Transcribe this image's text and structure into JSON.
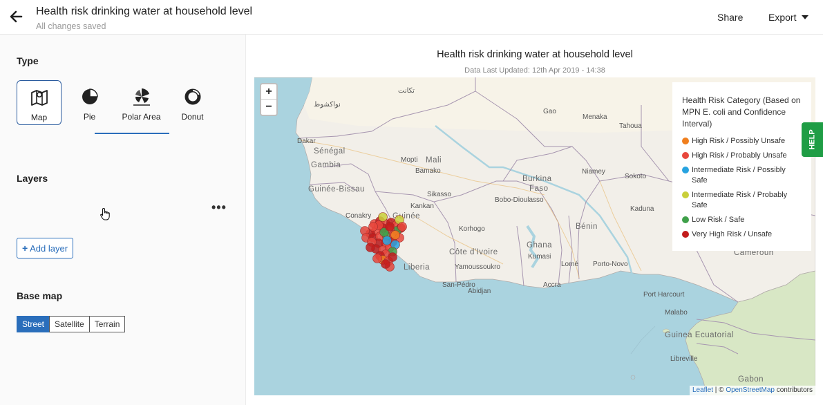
{
  "header": {
    "title": "Health risk drinking water at household level",
    "subtitle": "All changes saved",
    "share_label": "Share",
    "export_label": "Export"
  },
  "sidebar": {
    "type_title": "Type",
    "types": [
      {
        "label": "Map",
        "icon": "map-icon",
        "active": true
      },
      {
        "label": "Pie",
        "icon": "pie-chart-icon"
      },
      {
        "label": "Polar Area",
        "icon": "polar-area-icon"
      },
      {
        "label": "Donut",
        "icon": "donut-icon"
      }
    ],
    "layers_title": "Layers",
    "add_layer_label": "Add layer",
    "more_label": "•••",
    "basemap_title": "Base map",
    "basemaps": [
      "Street",
      "Satellite",
      "Terrain"
    ],
    "basemap_selected": "Street"
  },
  "chart": {
    "title": "Health risk drinking water at household level",
    "updated": "Data Last Updated: 12th Apr 2019 - 14:38"
  },
  "map": {
    "zoom_in": "+",
    "zoom_out": "−",
    "place_labels": [
      {
        "text": "Dakar"
      },
      {
        "text": "Sénégal"
      },
      {
        "text": "Gambia"
      },
      {
        "text": "Guinée-Bissau"
      },
      {
        "text": "Conakry"
      },
      {
        "text": "Guinée"
      },
      {
        "text": "Bamako"
      },
      {
        "text": "Mali"
      },
      {
        "text": "Mopti"
      },
      {
        "text": "Sikasso"
      },
      {
        "text": "Kankan"
      },
      {
        "text": "Korhogo"
      },
      {
        "text": "Côte d'Ivoire"
      },
      {
        "text": "Liberia"
      },
      {
        "text": "Yamoussoukro"
      },
      {
        "text": "San-Pédro"
      },
      {
        "text": "Abidjan"
      },
      {
        "text": "Burkina"
      },
      {
        "text": "Faso"
      },
      {
        "text": "Bobo-Dioulasso"
      },
      {
        "text": "Niamey"
      },
      {
        "text": "Sokoto"
      },
      {
        "text": "Kaduna"
      },
      {
        "text": "Bénin"
      },
      {
        "text": "Ghana"
      },
      {
        "text": "Kumasi"
      },
      {
        "text": "Accra"
      },
      {
        "text": "Lomé"
      },
      {
        "text": "Porto-Novo"
      },
      {
        "text": "Port Harcourt"
      },
      {
        "text": "Malabo"
      },
      {
        "text": "Cameroun"
      },
      {
        "text": "Guinea Ecuatorial"
      },
      {
        "text": "Libreville"
      },
      {
        "text": "Gabon"
      },
      {
        "text": "Tahoua"
      },
      {
        "text": "Menaka"
      },
      {
        "text": "Gao"
      },
      {
        "text": "نواكشوط"
      },
      {
        "text": "تكانت"
      }
    ],
    "attribution": {
      "leaflet": "Leaflet",
      "sep": " | © ",
      "osm": "OpenStreetMap",
      "suffix": " contributors"
    }
  },
  "legend": {
    "title": "Health Risk Category (Based on MPN E. coli and Confidence Interval)",
    "items": [
      {
        "label": "High Risk / Possibly Unsafe",
        "color": "#f07f1e"
      },
      {
        "label": "High Risk / Probably Unsafe",
        "color": "#e8473c"
      },
      {
        "label": "Intermediate Risk / Possibly Safe",
        "color": "#27a3e0"
      },
      {
        "label": "Intermediate Risk / Probably Safe",
        "color": "#c9cf3a"
      },
      {
        "label": "Low Risk / Safe",
        "color": "#3fa04a"
      },
      {
        "label": "Very High Risk / Unsafe",
        "color": "#c21c1c"
      }
    ]
  },
  "help_label": "HELP"
}
